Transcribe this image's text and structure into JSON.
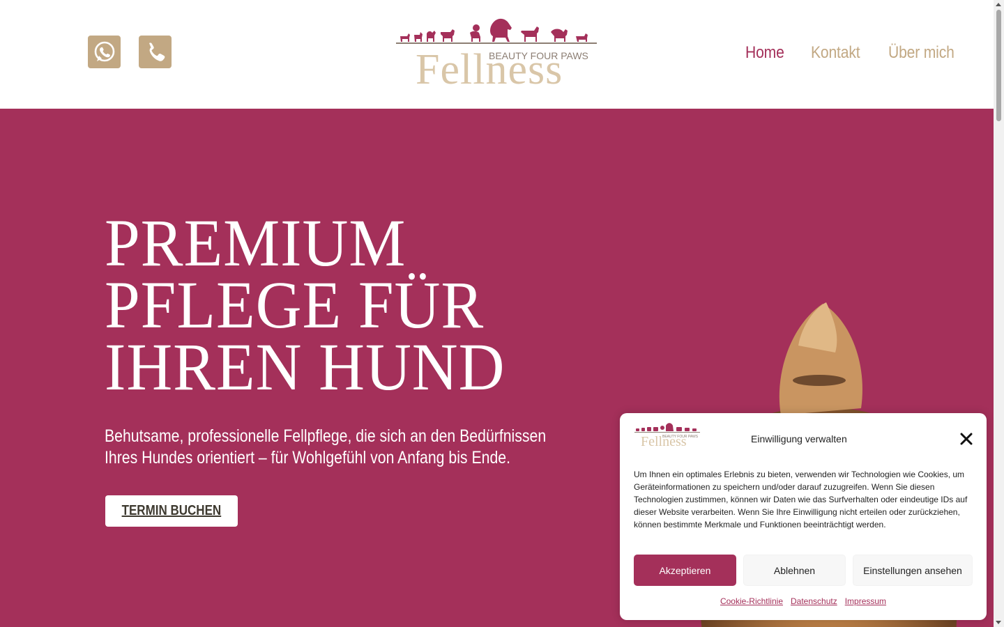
{
  "header": {
    "whatsapp_icon": "whatsapp-icon",
    "phone_icon": "phone-icon",
    "logo": {
      "tagline": "BEAUTY FOUR PAWS",
      "name": "Fellness"
    },
    "nav": [
      {
        "label": "Home",
        "active": true
      },
      {
        "label": "Kontakt",
        "active": false
      },
      {
        "label": "Über mich",
        "active": false
      }
    ]
  },
  "hero": {
    "title_lines": [
      "PREMIUM",
      "PFLEGE FÜR",
      "IHREN HUND"
    ],
    "subtitle_lines": [
      "Behutsame, professionelle Fellpflege, die sich an den Bedürfnissen",
      "Ihres Hundes orientiert – für Wohlgefühl von Anfang bis Ende."
    ],
    "cta_label": "TERMIN BUCHEN"
  },
  "consent": {
    "title": "Einwilligung verwalten",
    "logo_tagline": "BEAUTY FOUR PAWS",
    "logo_name": "Fellness",
    "text": "Um Ihnen ein optimales Erlebnis zu bieten, verwenden wir Technologien wie Cookies, um Geräteinformationen zu speichern und/oder darauf zuzugreifen. Wenn Sie diesen Technologien zustimmen, können wir Daten wie das Surfverhalten oder eindeutige IDs auf dieser Website verarbeiten. Wenn Sie Ihre Einwilligung nicht erteilen oder zurückziehen, können bestimmte Merkmale und Funktionen beeinträchtigt werden.",
    "accept_label": "Akzeptieren",
    "deny_label": "Ablehnen",
    "settings_label": "Einstellungen ansehen",
    "links": [
      "Cookie-Richtlinie",
      "Datenschutz",
      "Impressum"
    ]
  },
  "colors": {
    "brand": "#a4305a",
    "gold": "#c2a883",
    "white": "#ffffff"
  }
}
